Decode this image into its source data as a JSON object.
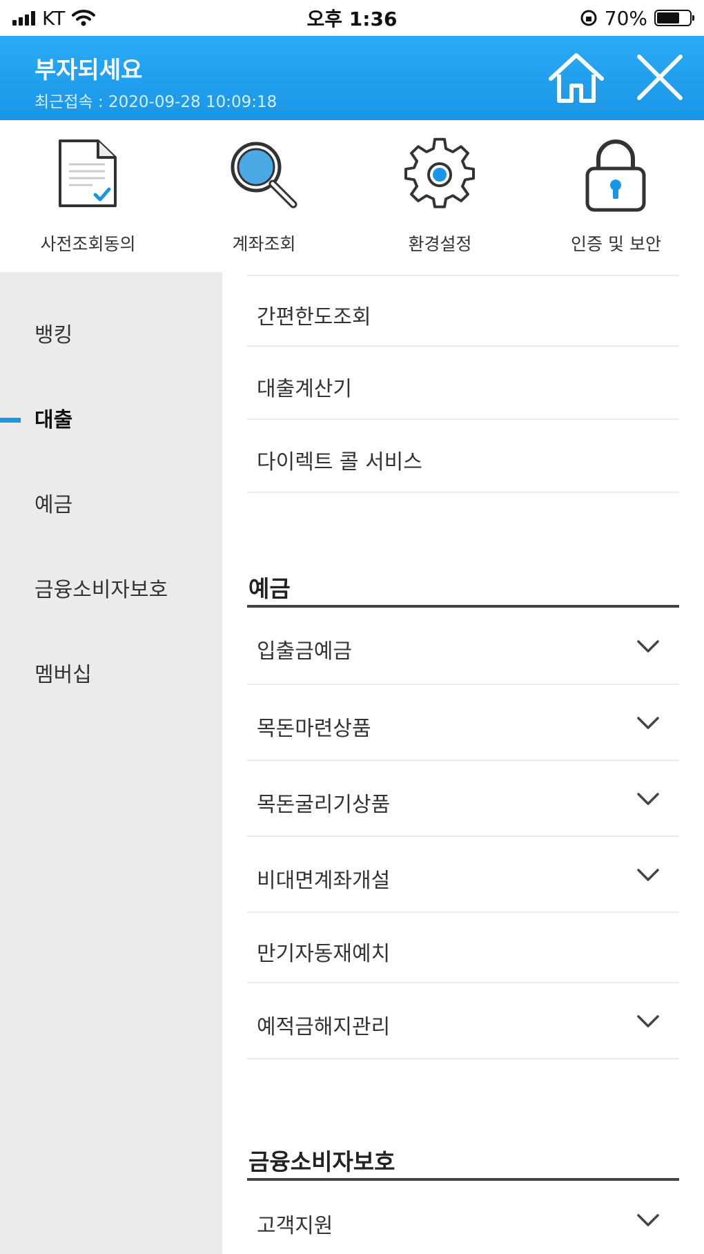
{
  "status_bar": {
    "carrier": "KT",
    "time": "오후 1:36",
    "battery": "70%",
    "battery_level": 0.7
  },
  "header": {
    "title": "부자되세요",
    "last_access": "최근접속 : 2020-09-28 10:09:18",
    "icons": [
      "home-icon",
      "close-icon"
    ]
  },
  "quick_menu": [
    {
      "label": "사전조회동의",
      "icon": "document-check-icon"
    },
    {
      "label": "계좌조회",
      "icon": "search-icon"
    },
    {
      "label": "환경설정",
      "icon": "gear-icon"
    },
    {
      "label": "인증 및 보안",
      "icon": "lock-icon"
    }
  ],
  "sidebar": {
    "items": [
      {
        "label": "뱅킹"
      },
      {
        "label": "대출"
      },
      {
        "label": "예금"
      },
      {
        "label": "금융소비자보호"
      },
      {
        "label": "멤버십"
      }
    ],
    "active": "대출"
  },
  "content": {
    "loan_items": [
      {
        "label": "간편한도조회"
      },
      {
        "label": "대출계산기"
      },
      {
        "label": "다이렉트 콜 서비스"
      }
    ],
    "deposit_section": {
      "title": "예금",
      "items": [
        {
          "label": "입출금예금",
          "expandable": true
        },
        {
          "label": "목돈마련상품",
          "expandable": true
        },
        {
          "label": "목돈굴리기상품",
          "expandable": true
        },
        {
          "label": "비대면계좌개설",
          "expandable": true
        },
        {
          "label": "만기자동재예치",
          "expandable": false
        },
        {
          "label": "예적금해지관리",
          "expandable": true
        }
      ]
    },
    "consumer_section": {
      "title": "금융소비자보호",
      "items": [
        {
          "label": "고객지원",
          "expandable": true
        }
      ]
    }
  },
  "colors": {
    "header_blue": "#1a96e8",
    "accent_blue": "#1a96e8",
    "sidebar_bg": "#ebebeb"
  }
}
